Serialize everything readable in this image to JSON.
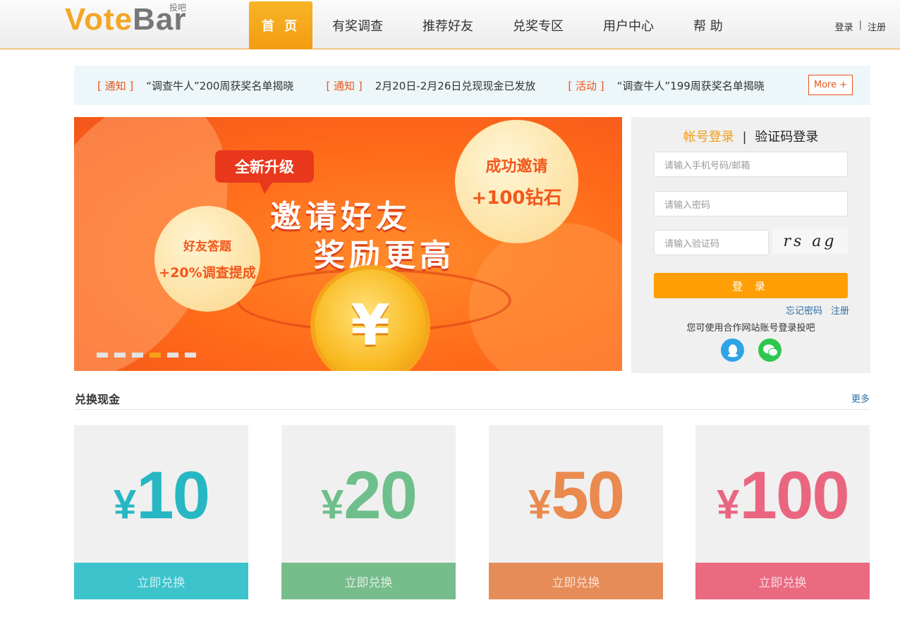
{
  "header": {
    "logo_main_v": "V",
    "logo_main_rest_o": "ote",
    "logo_main_rest_b": "Bar",
    "logo_sub": "投吧",
    "nav": [
      {
        "label": "首 页",
        "active": true
      },
      {
        "label": "有奖调查"
      },
      {
        "label": "推荐好友"
      },
      {
        "label": "兑奖专区"
      },
      {
        "label": "用户中心"
      },
      {
        "label": "帮 助"
      }
    ],
    "login_link": "登录",
    "separator": "|",
    "register_link": "注册"
  },
  "notices": [
    {
      "tag": "[ 通知 ]",
      "text": "“调查牛人”200周获奖名单揭晓"
    },
    {
      "tag": "[ 通知 ]",
      "text": "2月20日-2月26日兑现现金已发放"
    },
    {
      "tag": "[ 活动 ]",
      "text": "“调查牛人”199周获奖名单揭晓"
    }
  ],
  "notice_more": "More +",
  "banner": {
    "badge": "全新升级",
    "headline_1": "邀请好友",
    "headline_2": "奖励更高",
    "left_circle_1": "好友答题",
    "left_circle_2": "+20%调查提成",
    "right_circle_1": "成功邀请",
    "right_circle_2": "+100钻石",
    "coin_symbol": "¥",
    "active_slide": 4,
    "slide_count": 6
  },
  "login": {
    "tab_account": "帐号登录",
    "tab_divider": "|",
    "tab_sms": "验证码登录",
    "phone_placeholder": "请输入手机号码/邮箱",
    "password_placeholder": "请输入密码",
    "captcha_placeholder": "请输入验证码",
    "captcha_text": "rs ag",
    "submit": "登 录",
    "forgot": "忘记密码",
    "register": "注册",
    "partner_text": "您可使用合作网站账号登录投吧",
    "social": [
      "qq-icon",
      "wechat-icon"
    ]
  },
  "exchange": {
    "title": "兑换现金",
    "more": "更多",
    "cards": [
      {
        "yen": "¥",
        "amount": "10",
        "button": "立即兑换",
        "color": "#27b7c3",
        "btn_color": "#3cc3cc"
      },
      {
        "yen": "¥",
        "amount": "20",
        "button": "立即兑换",
        "color": "#6ebf8b",
        "btn_color": "#77bd8c"
      },
      {
        "yen": "¥",
        "amount": "50",
        "button": "立即兑换",
        "color": "#ea8a4e",
        "btn_color": "#e68c58"
      },
      {
        "yen": "¥",
        "amount": "100",
        "button": "立即兑换",
        "color": "#ea6680",
        "btn_color": "#ea6a80"
      }
    ]
  }
}
